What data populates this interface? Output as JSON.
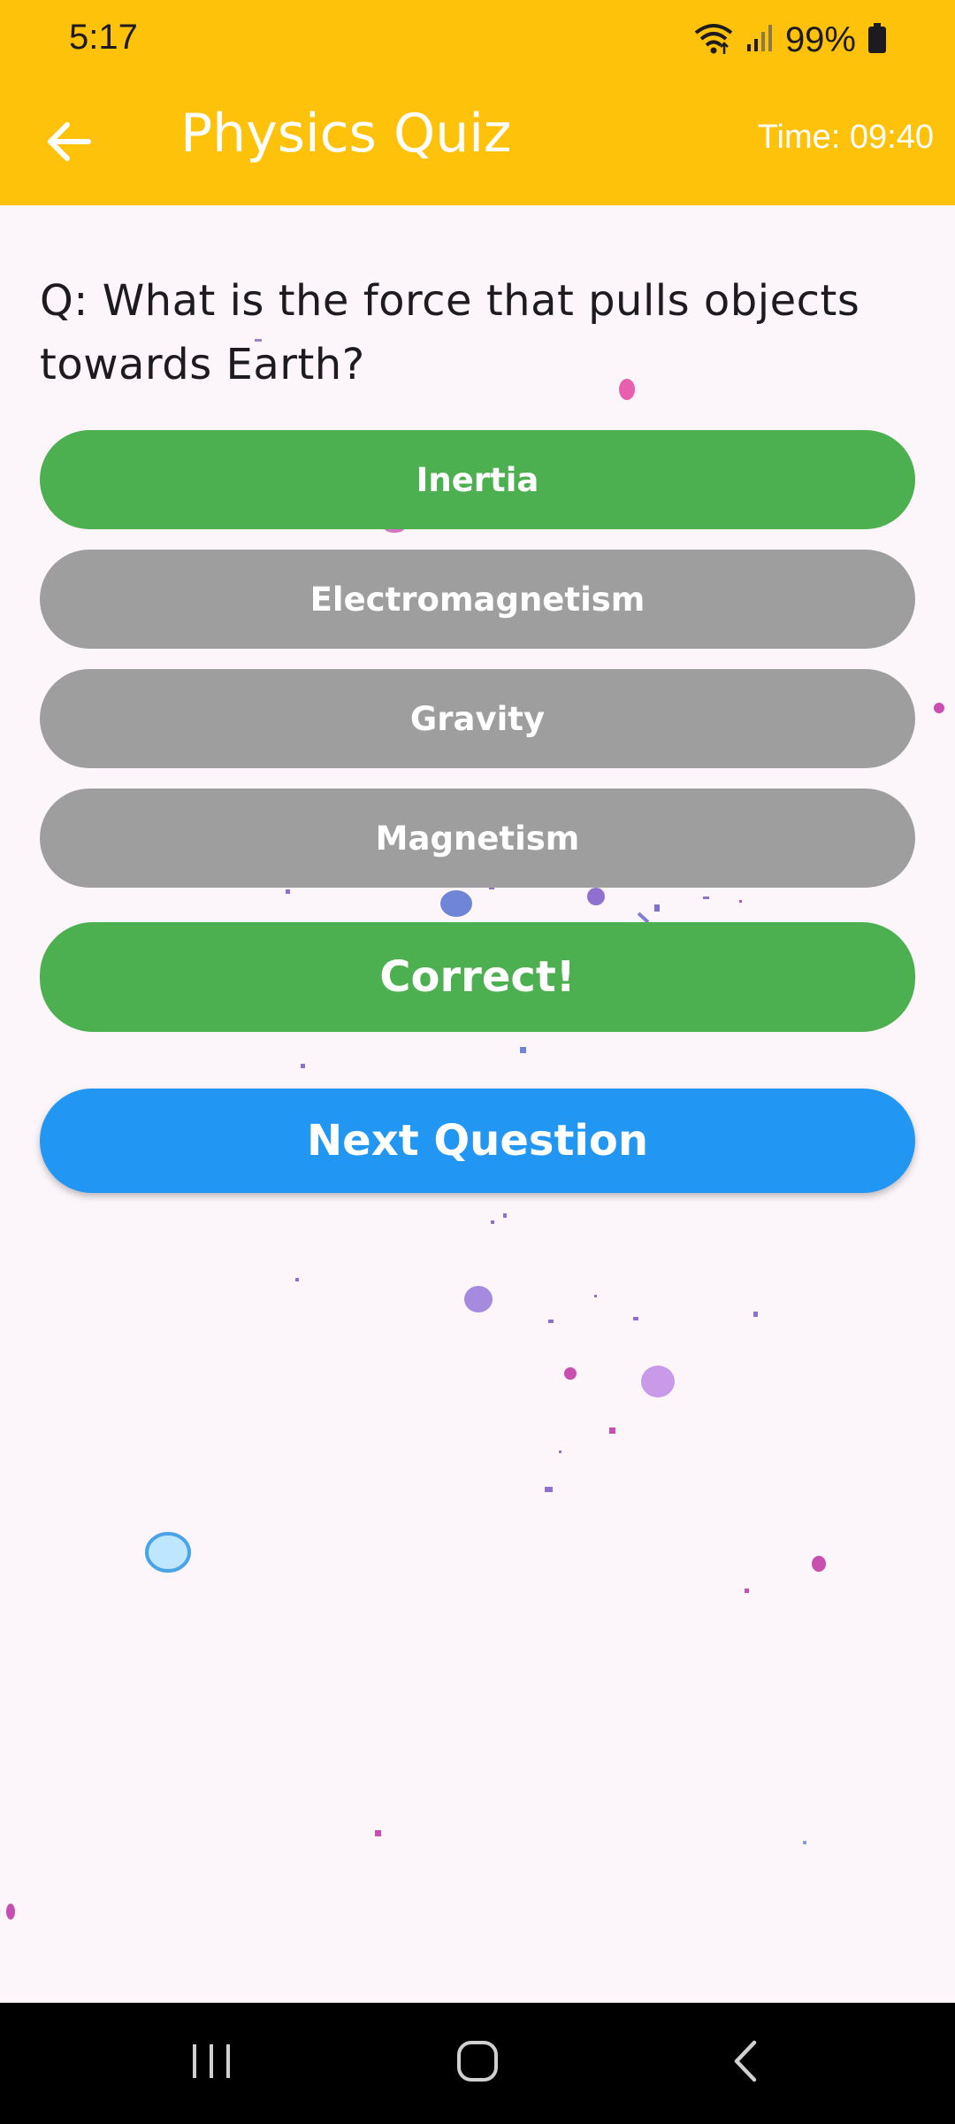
{
  "status_bar": {
    "time": "5:17",
    "battery": "99%",
    "icons": [
      "wifi-icon",
      "signal-icon",
      "battery-icon"
    ]
  },
  "app_bar": {
    "back_icon": "arrow-back-icon",
    "title": "Physics Quiz",
    "timer": "Time: 09:40",
    "color": "#FFC20A"
  },
  "quiz": {
    "question": "Q: What is the force that pulls objects towards Earth?",
    "options": [
      {
        "label": "Inertia",
        "state": "selected",
        "color": "#4CAF50"
      },
      {
        "label": "Electromagnetism",
        "state": "default",
        "color": "#9E9E9E"
      },
      {
        "label": "Gravity",
        "state": "default",
        "color": "#9E9E9E"
      },
      {
        "label": "Magnetism",
        "state": "default",
        "color": "#9E9E9E"
      }
    ],
    "feedback": "Correct!",
    "next_button": "Next Question"
  },
  "nav_bar": {
    "icons": [
      "recent-apps-icon",
      "home-icon",
      "back-icon"
    ]
  }
}
